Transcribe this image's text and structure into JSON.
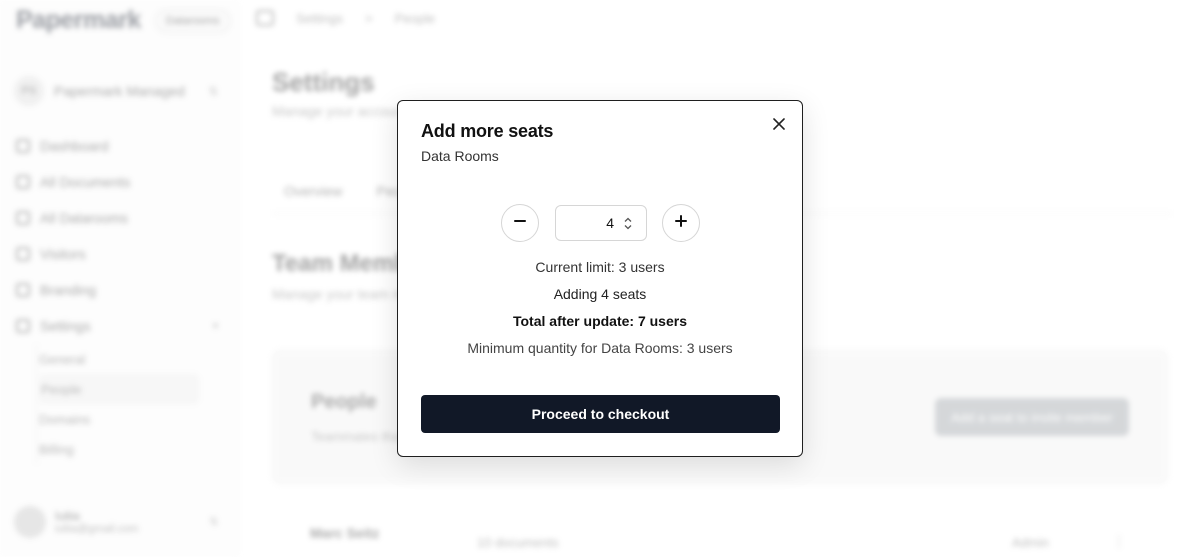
{
  "sidebar": {
    "logo": "Papermark",
    "plan_badge": "Datarooms",
    "team": {
      "initials": "PS",
      "name": "Papermark Managed"
    },
    "nav": [
      {
        "label": "Dashboard"
      },
      {
        "label": "All Documents"
      },
      {
        "label": "All Datarooms"
      },
      {
        "label": "Visitors"
      },
      {
        "label": "Branding"
      },
      {
        "label": "Settings"
      }
    ],
    "settings_subnav": [
      {
        "label": "General"
      },
      {
        "label": "People"
      },
      {
        "label": "Domains"
      },
      {
        "label": "Billing"
      }
    ],
    "user": {
      "name": "Iuliia",
      "email": "iuliia@gmail.com"
    }
  },
  "header": {
    "breadcrumb": [
      "Settings",
      "People"
    ],
    "breadcrumb_separator": ">"
  },
  "main": {
    "title": "Settings",
    "subtitle": "Manage your account settings",
    "tabs": [
      "Overview",
      "People"
    ],
    "team_title": "Team Members",
    "team_subtitle": "Manage your team members",
    "people_card": {
      "title": "People",
      "subtitle": "Teammates that have access",
      "button": "Add a seat to invite member"
    },
    "member": {
      "name": "Marc Seitz",
      "documents": "10 documents",
      "role": "Admin",
      "menu": "⋮"
    }
  },
  "modal": {
    "title": "Add more seats",
    "subtitle": "Data Rooms",
    "quantity": "4",
    "current_limit": "Current limit: 3 users",
    "adding": "Adding 4 seats",
    "total": "Total after update: 7 users",
    "minimum": "Minimum quantity for Data Rooms: 3 users",
    "checkout_label": "Proceed to checkout",
    "icons": {
      "close": "close-icon",
      "minus": "minus-icon",
      "plus": "plus-icon",
      "spinner": "spinner-arrows-icon"
    }
  },
  "colors": {
    "primary_button": "#111827",
    "modal_border": "#1f1f1f"
  }
}
